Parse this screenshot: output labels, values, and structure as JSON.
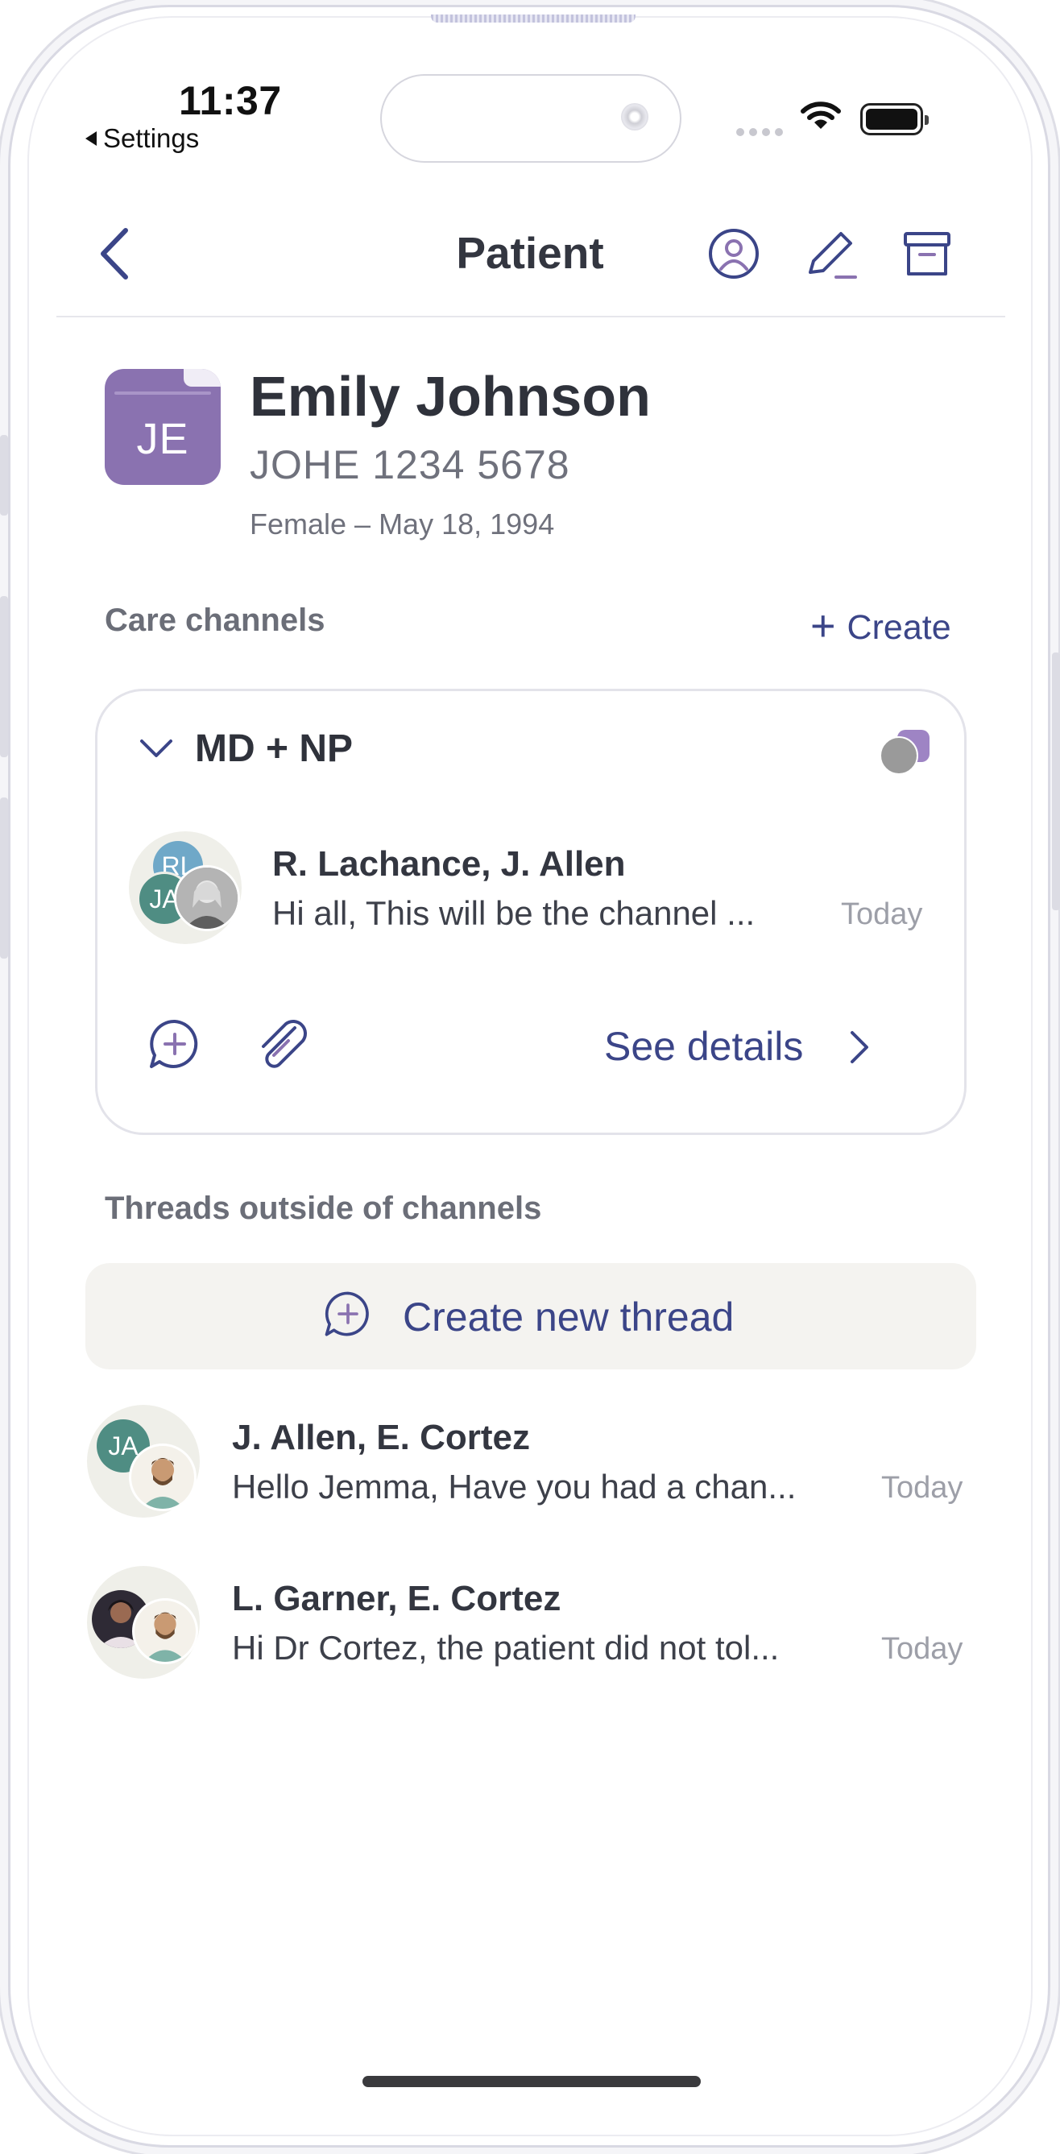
{
  "status_bar": {
    "time": "11:37",
    "back_app": "Settings"
  },
  "nav": {
    "title": "Patient"
  },
  "patient": {
    "initials": "JE",
    "name": "Emily Johnson",
    "id": "JOHE 1234 5678",
    "meta": "Female  –  May 18, 1994"
  },
  "care_channels": {
    "label": "Care channels",
    "create_label": "Create",
    "channel": {
      "title": "MD + NP",
      "participants": "R. Lachance, J. Allen",
      "preview": "Hi all, This will be the channel ...",
      "time": "Today",
      "avatar_initials": [
        "RL",
        "JA"
      ],
      "see_details_label": "See details"
    }
  },
  "outside_threads": {
    "label": "Threads outside of channels",
    "create_thread_label": "Create new thread",
    "threads": [
      {
        "participants": "J. Allen, E. Cortez",
        "preview": "Hello Jemma, Have you had a chan...",
        "time": "Today",
        "initials": "JA"
      },
      {
        "participants": "L. Garner, E. Cortez",
        "preview": "Hi Dr Cortez, the patient did not tol...",
        "time": "Today",
        "initials": ""
      }
    ]
  },
  "colors": {
    "accent": "#3b4588",
    "avatar_purple": "#8a72b0",
    "teal": "#4f8d83",
    "blue": "#6fa8c8"
  }
}
